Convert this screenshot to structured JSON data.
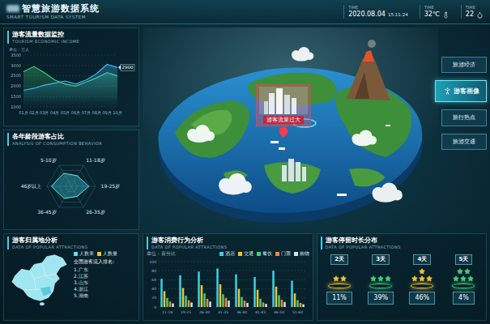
{
  "header": {
    "title": "智慧旅游数据系统",
    "subtitle": "SMART TOURISM DATA SYSTEM",
    "stats": [
      {
        "kind": "datetime",
        "label": "TIME",
        "value": "2020.08.04",
        "extra": "15:11:24"
      },
      {
        "kind": "temperature",
        "label": "TIME",
        "value": "32℃"
      },
      {
        "kind": "humidity",
        "label": "TIME",
        "value": "22"
      }
    ]
  },
  "flow": {
    "title": "游客流量数据监控",
    "subtitle": "TOURISM ECONOMIC INCOME",
    "unit": "单位：万人",
    "y_ticks": [
      "3500",
      "3000",
      "2500",
      "2000",
      "1500",
      "1000"
    ],
    "x_labels": [
      "01月",
      "02月",
      "03月",
      "04月",
      "05月",
      "06月",
      "07月",
      "08月",
      "09月",
      "10月"
    ],
    "series": [
      {
        "color": "#3fd07a",
        "values": [
          2700,
          2950,
          2650,
          2300,
          2100,
          2000,
          2200,
          2400,
          2650,
          2500
        ]
      },
      {
        "color": "#3fb6f0",
        "values": [
          1800,
          1900,
          2050,
          2150,
          2250,
          2100,
          2300,
          2600,
          3050,
          2900
        ]
      }
    ],
    "marker": "2900"
  },
  "ages": {
    "title": "各年龄段游客占比",
    "subtitle": "ANALYSIS OF CONSUMPTION BEHAVIOR",
    "axes": [
      {
        "label": "5-10岁",
        "level": 0.62
      },
      {
        "label": "11-18岁",
        "level": 0.5
      },
      {
        "label": "19-25岁",
        "level": 0.72
      },
      {
        "label": "26-35岁",
        "level": 0.48
      },
      {
        "label": "36-45岁",
        "level": 0.58
      },
      {
        "label": "46岁以上",
        "level": 0.82
      }
    ]
  },
  "origin": {
    "title": "游客归属地分析",
    "subtitle": "DATA OF POPULAR ATTRACTIONS",
    "legend": [
      {
        "label": "人数率",
        "color": "#5fe0f0"
      },
      {
        "label": "人数量",
        "color": "#f2c230"
      }
    ],
    "ranking_title": "全国游客流入排名:",
    "ranking": [
      "1.广东",
      "2.江苏",
      "3.山东",
      "4.浙江",
      "5.湖南"
    ]
  },
  "map": {
    "alert": "游客流量过大"
  },
  "nav": [
    {
      "label": "旅游经济",
      "selected": false
    },
    {
      "label": "游客画像",
      "selected": true
    },
    {
      "label": "旅行热点",
      "selected": false
    },
    {
      "label": "旅游交通",
      "selected": false
    }
  ],
  "consumption": {
    "title": "游客消费行为分析",
    "subtitle": "DATA OF POPULAR ATTRACTIONS",
    "unit": "单位：百分比",
    "y_ticks": [
      "100",
      "80",
      "60",
      "40",
      "20",
      "0"
    ],
    "x_labels": [
      "11-18",
      "19-25",
      "26-30",
      "31-35",
      "36-40",
      "41-45",
      "46-50",
      "51-60"
    ],
    "series": [
      {
        "name": "酒店",
        "color": "#3fd0e0",
        "values": [
          62,
          70,
          78,
          85,
          72,
          66,
          80,
          58
        ]
      },
      {
        "name": "交通",
        "color": "#f2c230",
        "values": [
          35,
          42,
          48,
          50,
          40,
          38,
          45,
          30
        ]
      },
      {
        "name": "餐饮",
        "color": "#3fd07a",
        "values": [
          20,
          25,
          30,
          28,
          22,
          18,
          26,
          15
        ]
      },
      {
        "name": "门票",
        "color": "#f08a30",
        "values": [
          12,
          15,
          18,
          20,
          14,
          10,
          16,
          9
        ]
      },
      {
        "name": "购物",
        "color": "#c8e8f0",
        "values": [
          8,
          10,
          12,
          14,
          9,
          7,
          11,
          6
        ]
      }
    ]
  },
  "stay": {
    "title": "游客停留时长分布",
    "subtitle": "DATA OF POPULAR ATTRACTIONS",
    "items": [
      {
        "label": "2天",
        "stars": 2,
        "color": "#f2c230",
        "percent": "11%"
      },
      {
        "label": "3天",
        "stars": 3,
        "color": "#3fd07a",
        "percent": "39%"
      },
      {
        "label": "4天",
        "stars": 4,
        "color": "#f2c230",
        "percent": "46%"
      },
      {
        "label": "5天",
        "stars": 5,
        "color": "#3fd07a",
        "percent": "4%"
      }
    ]
  }
}
